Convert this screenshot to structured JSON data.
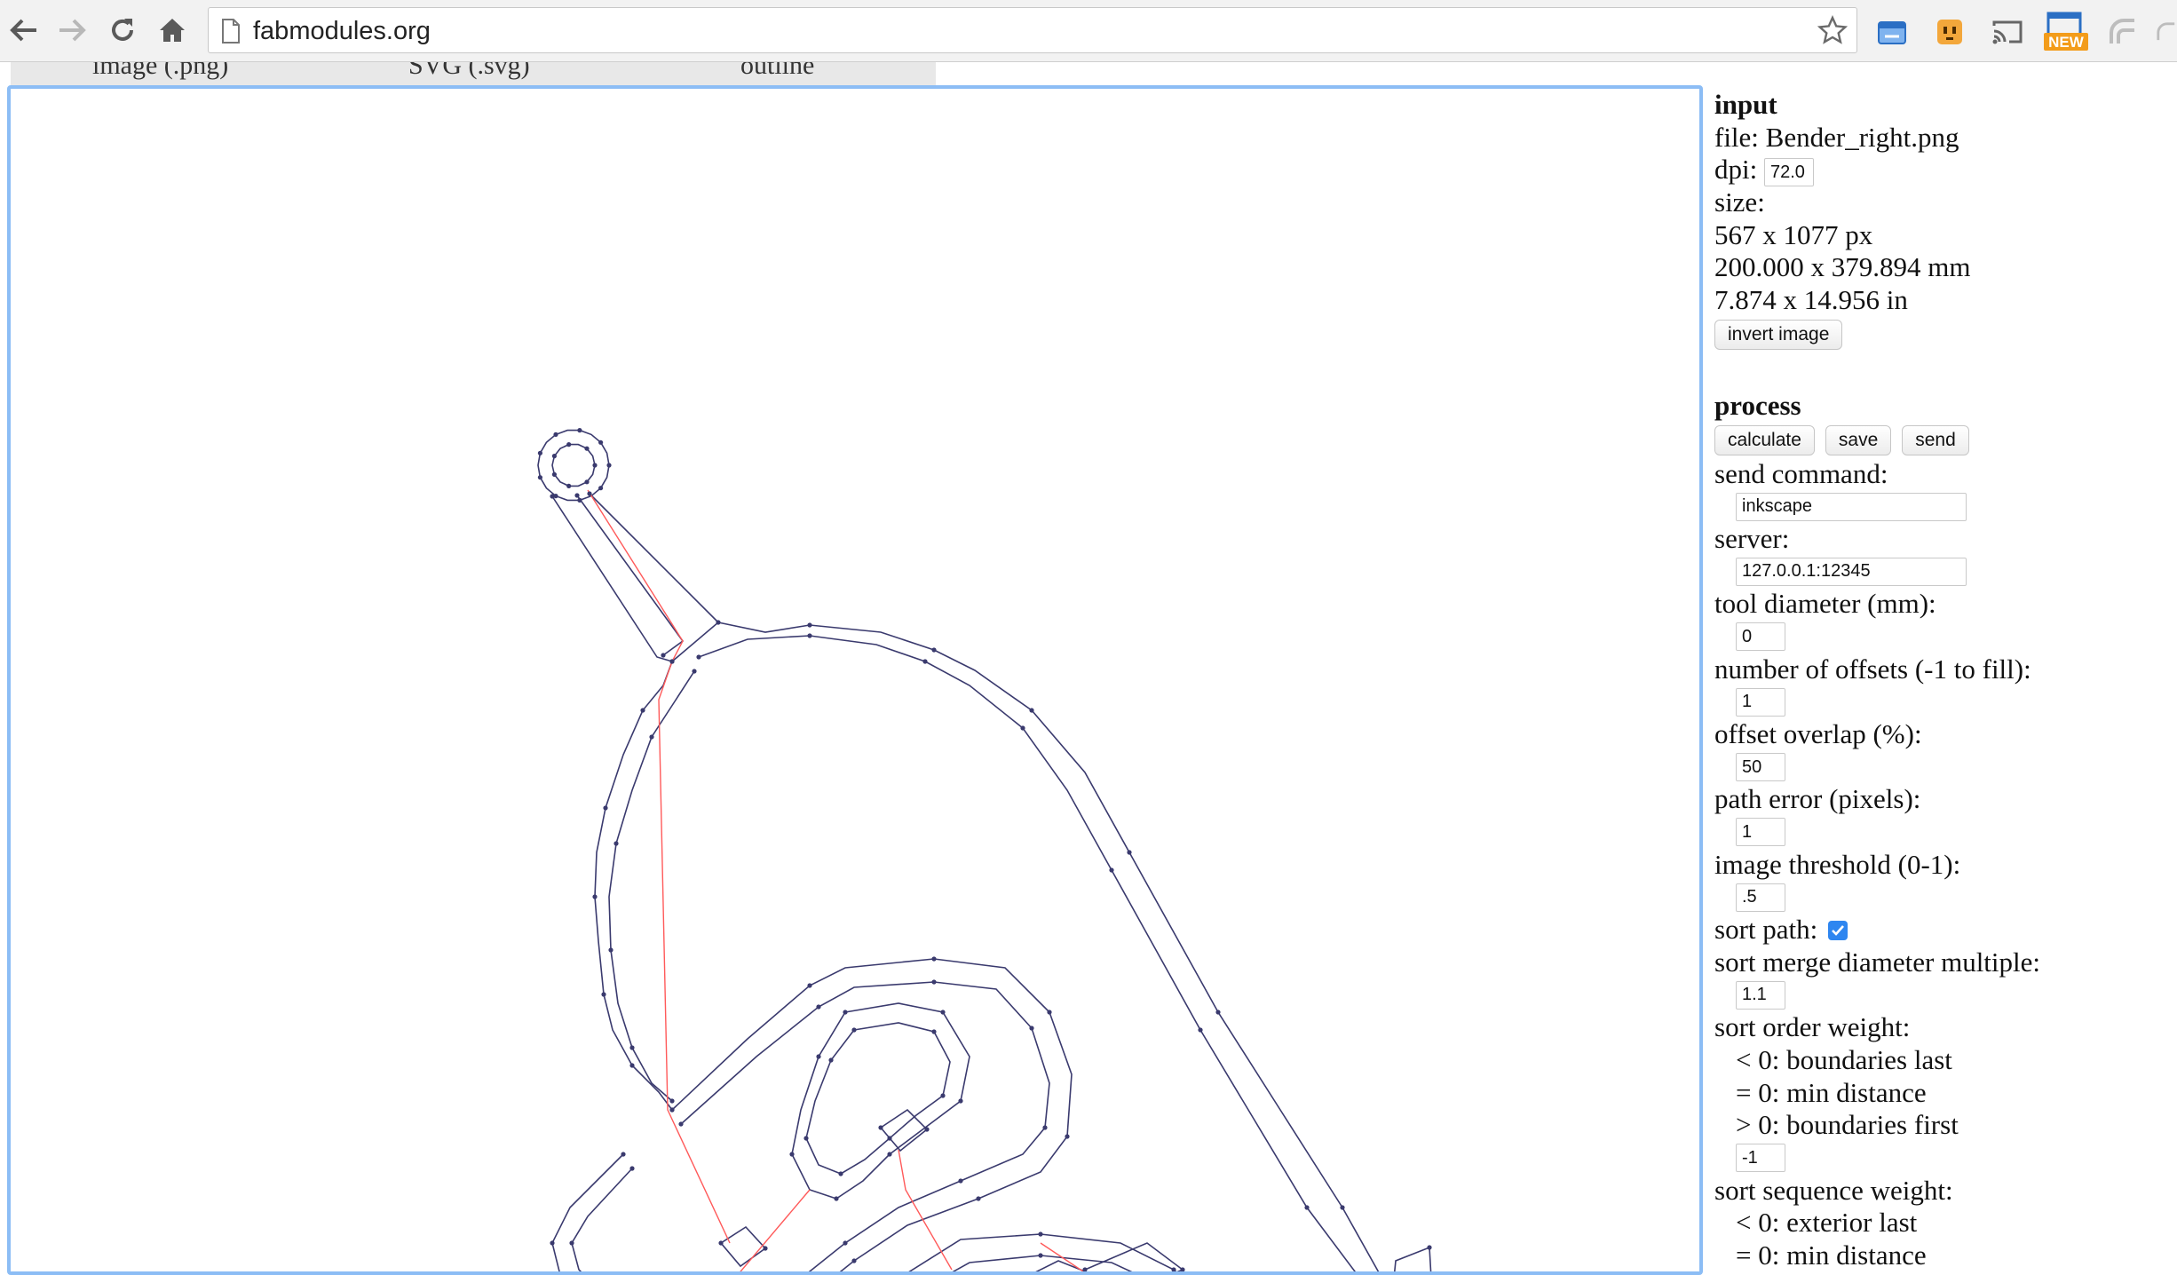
{
  "browser": {
    "url": "fabmodules.org",
    "icons": [
      "back-arrow-icon",
      "forward-arrow-icon",
      "reload-icon",
      "home-icon",
      "page-icon",
      "star-icon",
      "extension-icons"
    ]
  },
  "top_strip": {
    "labels": [
      "image (.png)",
      "SVG (.svg)",
      "outline"
    ]
  },
  "input": {
    "heading": "input",
    "file_label": "file: Bender_right.png",
    "dpi_label": "dpi:",
    "dpi_value": "72.0",
    "size_label": "size:",
    "size_px": "567 x 1077 px",
    "size_mm": "200.000 x 379.894 mm",
    "size_in": "7.874 x 14.956 in",
    "invert_button": "invert image"
  },
  "process": {
    "heading": "process",
    "calculate_button": "calculate",
    "save_button": "save",
    "send_button": "send",
    "send_command_label": "send command:",
    "send_command_value": "inkscape",
    "server_label": "server:",
    "server_value": "127.0.0.1:12345",
    "tool_diameter_label": "tool diameter (mm):",
    "tool_diameter_value": "0",
    "offsets_label": "number of offsets (-1 to fill):",
    "offsets_value": "1",
    "overlap_label": "offset overlap (%):",
    "overlap_value": "50",
    "path_error_label": "path error (pixels):",
    "path_error_value": "1",
    "threshold_label": "image threshold (0-1):",
    "threshold_value": ".5",
    "sort_path_label": "sort path:",
    "sort_path_checked": true,
    "merge_label": "sort merge diameter multiple:",
    "merge_value": "1.1",
    "order_weight_label": "sort order weight:",
    "order_weight_lines": [
      "< 0: boundaries last",
      "= 0: min distance",
      "> 0: boundaries first"
    ],
    "order_weight_value": "-1",
    "sequence_weight_label": "sort sequence weight:",
    "sequence_weight_lines": [
      "< 0: exterior last",
      "= 0: min distance"
    ]
  },
  "colors": {
    "path": "#3a3a6e",
    "move": "#ff5a5a",
    "canvas_border": "#8cbdf5",
    "checkbox": "#2e86f0"
  }
}
